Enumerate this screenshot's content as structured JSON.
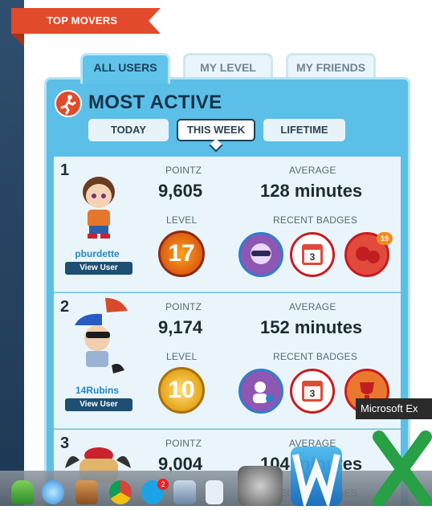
{
  "header": {
    "ribbon_label": "TOP MOVERS"
  },
  "tabs": [
    {
      "label": "ALL USERS"
    },
    {
      "label": "MY LEVEL"
    },
    {
      "label": "MY FRIENDS"
    }
  ],
  "panel_title": "MOST ACTIVE",
  "filters": [
    {
      "label": "TODAY"
    },
    {
      "label": "THIS WEEK"
    },
    {
      "label": "LIFETIME"
    }
  ],
  "selected_filter": "THIS WEEK",
  "labels": {
    "pointz": "POINTZ",
    "average": "AVERAGE",
    "level": "LEVEL",
    "recent_badges": "RECENT BADGES",
    "view_user": "View User"
  },
  "users": [
    {
      "rank": "1",
      "name": "pburdette",
      "pointz": "9,605",
      "average": "128 minutes",
      "level": "17",
      "badge_count": "19"
    },
    {
      "rank": "2",
      "name": "14Rubins",
      "pointz": "9,174",
      "average": "152 minutes",
      "level": "10"
    },
    {
      "rank": "3",
      "pointz": "9,004",
      "average": "104 minutes"
    }
  ],
  "badges": {
    "calendar_day": "3",
    "skype_notification": "2"
  },
  "tooltip": "Microsoft Ex",
  "colors": {
    "accent": "#e14a2a",
    "panel": "#5bbfe8",
    "card": "#eaf5fb",
    "link": "#2386c7"
  }
}
